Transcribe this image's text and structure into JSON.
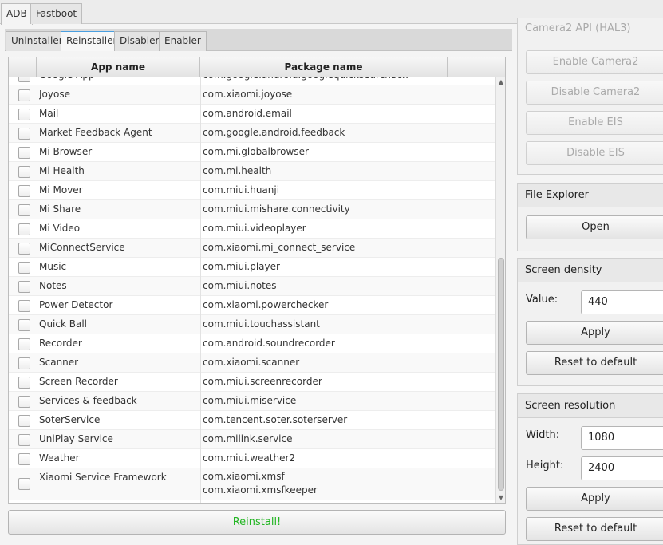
{
  "top_tabs": [
    "ADB",
    "Fastboot"
  ],
  "sub_tabs": [
    "Uninstaller",
    "Reinstaller",
    "Disabler",
    "Enabler"
  ],
  "table": {
    "headers": [
      "App name",
      "Package name"
    ],
    "rows": [
      {
        "app": "Google App",
        "packages": [
          "com.google.android.googlequicksearchbox"
        ]
      },
      {
        "app": "Joyose",
        "packages": [
          "com.xiaomi.joyose"
        ]
      },
      {
        "app": "Mail",
        "packages": [
          "com.android.email"
        ]
      },
      {
        "app": "Market Feedback Agent",
        "packages": [
          "com.google.android.feedback"
        ]
      },
      {
        "app": "Mi Browser",
        "packages": [
          "com.mi.globalbrowser"
        ]
      },
      {
        "app": "Mi Health",
        "packages": [
          "com.mi.health"
        ]
      },
      {
        "app": "Mi Mover",
        "packages": [
          "com.miui.huanji"
        ]
      },
      {
        "app": "Mi Share",
        "packages": [
          "com.miui.mishare.connectivity"
        ]
      },
      {
        "app": "Mi Video",
        "packages": [
          "com.miui.videoplayer"
        ]
      },
      {
        "app": "MiConnectService",
        "packages": [
          "com.xiaomi.mi_connect_service"
        ]
      },
      {
        "app": "Music",
        "packages": [
          "com.miui.player"
        ]
      },
      {
        "app": "Notes",
        "packages": [
          "com.miui.notes"
        ]
      },
      {
        "app": "Power Detector",
        "packages": [
          "com.xiaomi.powerchecker"
        ]
      },
      {
        "app": "Quick Ball",
        "packages": [
          "com.miui.touchassistant"
        ]
      },
      {
        "app": "Recorder",
        "packages": [
          "com.android.soundrecorder"
        ]
      },
      {
        "app": "Scanner",
        "packages": [
          "com.xiaomi.scanner"
        ]
      },
      {
        "app": "Screen Recorder",
        "packages": [
          "com.miui.screenrecorder"
        ]
      },
      {
        "app": "Services & feedback",
        "packages": [
          "com.miui.miservice"
        ]
      },
      {
        "app": "SoterService",
        "packages": [
          "com.tencent.soter.soterserver"
        ]
      },
      {
        "app": "UniPlay Service",
        "packages": [
          "com.milink.service"
        ]
      },
      {
        "app": "Weather",
        "packages": [
          "com.miui.weather2"
        ]
      },
      {
        "app": "Xiaomi Service Framework",
        "packages": [
          "com.xiaomi.xmsf",
          "com.xiaomi.xmsfkeeper"
        ]
      }
    ]
  },
  "reinstall_button": "Reinstall!",
  "camera": {
    "api_label": "Camera2 API (HAL3)",
    "buttons": [
      "Enable Camera2",
      "Disable Camera2",
      "Enable EIS",
      "Disable EIS"
    ]
  },
  "file_explorer": {
    "title": "File Explorer",
    "open_button": "Open"
  },
  "screen_density": {
    "title": "Screen density",
    "value_label": "Value:",
    "value": "440",
    "apply_button": "Apply",
    "reset_button": "Reset to default"
  },
  "screen_resolution": {
    "title": "Screen resolution",
    "width_label": "Width:",
    "width": "1080",
    "height_label": "Height:",
    "height": "2400",
    "apply_button": "Apply",
    "reset_button": "Reset to default"
  },
  "colors": {
    "reinstall_text": "#22b522",
    "active_tab_border": "#4a9fe0"
  }
}
